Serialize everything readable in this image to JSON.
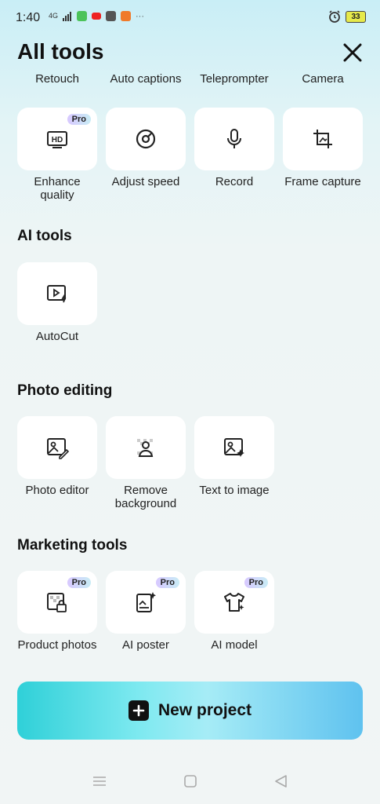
{
  "status": {
    "time": "1:40",
    "network": "4G",
    "battery": "33"
  },
  "header": {
    "title": "All tools"
  },
  "top_row_labels": [
    "Retouch",
    "Auto captions",
    "Teleprompter",
    "Camera"
  ],
  "editing_tools": [
    {
      "label": "Enhance quality",
      "pro": "Pro"
    },
    {
      "label": "Adjust speed",
      "pro": ""
    },
    {
      "label": "Record",
      "pro": ""
    },
    {
      "label": "Frame capture",
      "pro": ""
    }
  ],
  "sections": {
    "ai_tools": {
      "title": "AI tools",
      "items": [
        {
          "label": "AutoCut",
          "pro": ""
        }
      ]
    },
    "photo_editing": {
      "title": "Photo editing",
      "items": [
        {
          "label": "Photo editor",
          "pro": ""
        },
        {
          "label": "Remove background",
          "pro": ""
        },
        {
          "label": "Text to image",
          "pro": ""
        }
      ]
    },
    "marketing_tools": {
      "title": "Marketing tools",
      "items": [
        {
          "label": "Product photos",
          "pro": "Pro"
        },
        {
          "label": "AI poster",
          "pro": "Pro"
        },
        {
          "label": "AI model",
          "pro": "Pro"
        }
      ]
    }
  },
  "new_project": {
    "label": "New project"
  },
  "colors": {
    "accent_start": "#2fd0d8",
    "accent_end": "#5fc2ef",
    "tile": "#ffffff"
  }
}
